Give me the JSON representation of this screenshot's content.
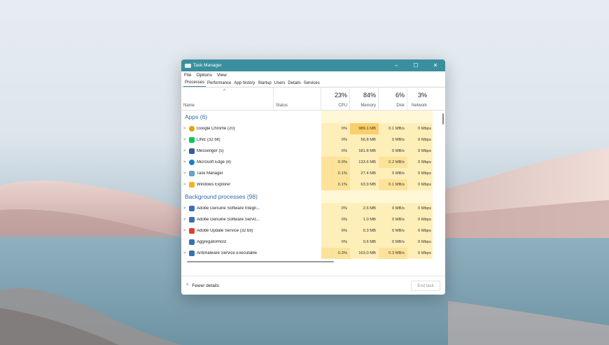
{
  "window": {
    "title": "Task Manager",
    "controls": {
      "minimize": "–",
      "maximize": "☐",
      "close": "✕"
    }
  },
  "menu": [
    "File",
    "Options",
    "View"
  ],
  "tabs": [
    {
      "label": "Processes",
      "active": true
    },
    {
      "label": "Performance"
    },
    {
      "label": "App history"
    },
    {
      "label": "Startup"
    },
    {
      "label": "Users"
    },
    {
      "label": "Details"
    },
    {
      "label": "Services"
    }
  ],
  "columns": {
    "name_label": "Name",
    "status_label": "Status",
    "cpu": {
      "pct": "23%",
      "label": "CPU"
    },
    "memory": {
      "pct": "84%",
      "label": "Memory"
    },
    "disk": {
      "pct": "6%",
      "label": "Disk"
    },
    "network": {
      "pct": "3%",
      "label": "Network"
    }
  },
  "groups": {
    "apps_label": "Apps (6)",
    "background_label": "Background processes (98)"
  },
  "apps": [
    {
      "name": "Google Chrome (20)",
      "icon": "chrome-icon",
      "color": "#e6a200",
      "cpu": "0%",
      "memory": "989.1 MB",
      "disk": "0.1 MB/s",
      "network": "0 Mbps",
      "expandable": true
    },
    {
      "name": "LINE (32 bit)",
      "icon": "line-icon",
      "color": "#06c755",
      "cpu": "0%",
      "memory": "56.8 MB",
      "disk": "0 MB/s",
      "network": "0 Mbps",
      "expandable": true
    },
    {
      "name": "Messenger (5)",
      "icon": "messenger-icon",
      "color": "#3d5a98",
      "cpu": "0%",
      "memory": "181.8 MB",
      "disk": "0 MB/s",
      "network": "0 Mbps",
      "expandable": true
    },
    {
      "name": "Microsoft Edge (8)",
      "icon": "edge-icon",
      "color": "#1a7ecb",
      "cpu": "0.9%",
      "memory": "133.6 MB",
      "disk": "0.2 MB/s",
      "network": "0 Mbps",
      "expandable": true
    },
    {
      "name": "Task Manager",
      "icon": "task-manager-icon",
      "color": "#66a3c9",
      "cpu": "0.1%",
      "memory": "27.4 MB",
      "disk": "0 MB/s",
      "network": "0 Mbps",
      "expandable": true
    },
    {
      "name": "Windows Explorer",
      "icon": "folder-icon",
      "color": "#f2b51c",
      "cpu": "0.1%",
      "memory": "63.9 MB",
      "disk": "0.1 MB/s",
      "network": "0 Mbps",
      "expandable": true
    }
  ],
  "background": [
    {
      "name": "Adobe Genuine Software Integri...",
      "icon": "service-icon",
      "color": "#3b6fb6",
      "cpu": "0%",
      "memory": "2.6 MB",
      "disk": "0 MB/s",
      "network": "0 Mbps",
      "expandable": true
    },
    {
      "name": "Adobe Genuine Software Servic...",
      "icon": "service-icon",
      "color": "#3b6fb6",
      "cpu": "0%",
      "memory": "1.0 MB",
      "disk": "0 MB/s",
      "network": "0 Mbps",
      "expandable": true
    },
    {
      "name": "Adobe Update Service (32 bit)",
      "icon": "adobe-cloud-icon",
      "color": "#e0402a",
      "cpu": "0%",
      "memory": "0.3 MB",
      "disk": "0 MB/s",
      "network": "0 Mbps",
      "expandable": true
    },
    {
      "name": "AggregatorHost",
      "icon": "service-icon",
      "color": "#3b6fb6",
      "cpu": "0%",
      "memory": "0.6 MB",
      "disk": "0 MB/s",
      "network": "0 Mbps",
      "expandable": false
    },
    {
      "name": "Antimalware Service Executable",
      "icon": "service-icon",
      "color": "#3b6fb6",
      "cpu": "0.3%",
      "memory": "163.0 MB",
      "disk": "0.3 MB/s",
      "network": "0 Mbps",
      "expandable": true
    }
  ],
  "footer": {
    "fewer_details": "Fewer details",
    "end_task": "End task"
  }
}
